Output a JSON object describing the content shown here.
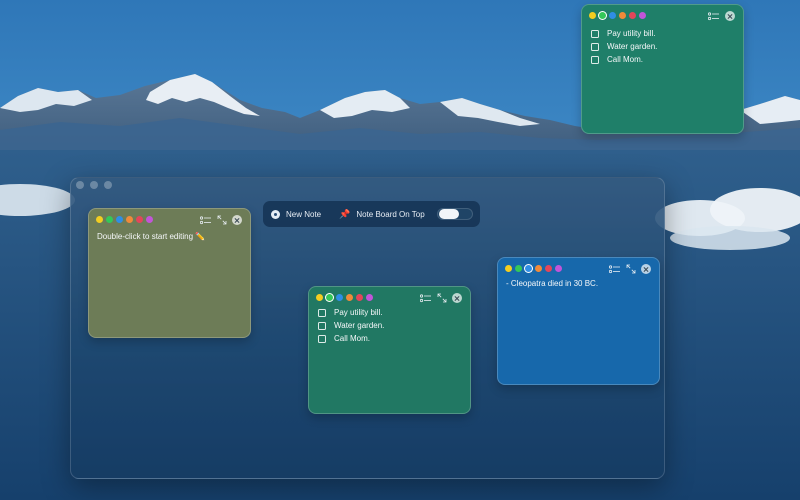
{
  "app": {
    "toolbar": {
      "new_note_label": "New Note",
      "on_top_label": "Note Board On Top",
      "on_top_enabled": false
    }
  },
  "palette": [
    "#f2cd21",
    "#34c759",
    "#2f8ee5",
    "#f08a3a",
    "#e2465a",
    "#c255d8"
  ],
  "notes": {
    "top": {
      "color": "#1f7f69",
      "selected_color_index": 1,
      "items": [
        {
          "text": "Pay utility bill.",
          "checked": false
        },
        {
          "text": "Water garden.",
          "checked": false
        },
        {
          "text": "Call Mom.",
          "checked": false
        }
      ]
    },
    "olive": {
      "color": "#6d7c57",
      "selected_color_index": null,
      "text": "Double-click to start editing ✏️"
    },
    "green": {
      "color": "#217863",
      "selected_color_index": 1,
      "items": [
        {
          "text": "Pay utility bill.",
          "checked": false
        },
        {
          "text": "Water garden.",
          "checked": false
        },
        {
          "text": "Call Mom.",
          "checked": false
        }
      ]
    },
    "blue": {
      "color": "#1768ab",
      "selected_color_index": 2,
      "text": "- Cleopatra died in 30 BC."
    }
  }
}
